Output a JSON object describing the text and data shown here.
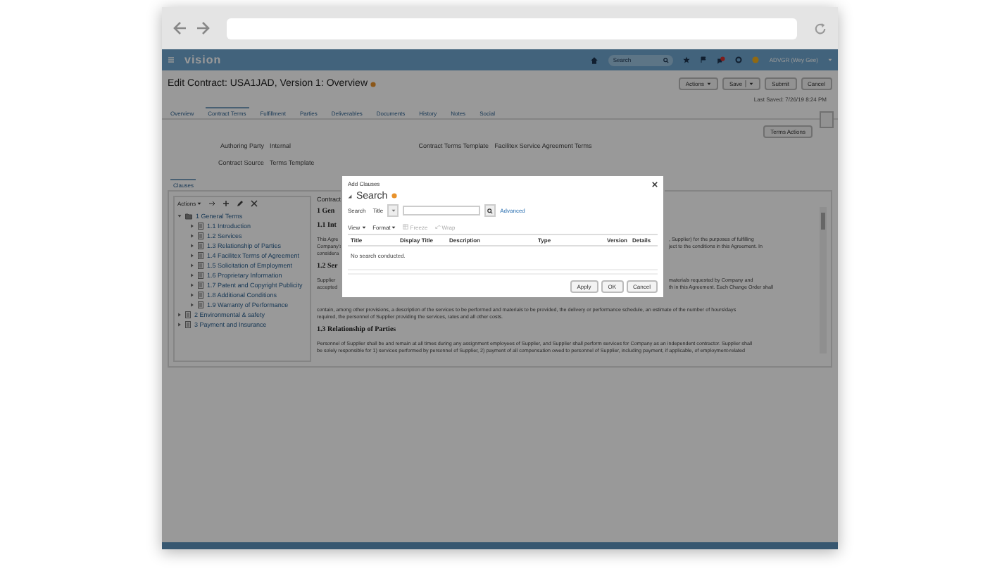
{
  "app": {
    "logo": "vision",
    "search": {
      "placeholder": "Search"
    },
    "user": "ADVGR (Wey Gee)"
  },
  "page": {
    "title": "Edit Contract: USA1JAD, Version 1: Overview",
    "buttons": [
      {
        "label": "Actions",
        "kind": "menu"
      },
      {
        "label": "Save",
        "kind": "split"
      },
      {
        "label": "Submit",
        "kind": "plain"
      },
      {
        "label": "Cancel",
        "kind": "plain"
      }
    ],
    "last_saved": "Last Saved: 7/26/19 8:24 PM"
  },
  "tabs": [
    {
      "label": "Overview",
      "selected": false
    },
    {
      "label": "Contract Terms",
      "selected": true
    },
    {
      "label": "Fulfillment",
      "selected": false
    },
    {
      "label": "Parties",
      "selected": false
    },
    {
      "label": "Deliverables",
      "selected": false
    },
    {
      "label": "Documents",
      "selected": false
    },
    {
      "label": "History",
      "selected": false
    },
    {
      "label": "Notes",
      "selected": false
    },
    {
      "label": "Social",
      "selected": false
    }
  ],
  "terms_actions": "Terms Actions",
  "fields": [
    {
      "label": "Authoring Party",
      "value": "Internal"
    },
    {
      "label": "Contract Terms Template",
      "value": "Facilitex Service Agreement Terms"
    },
    {
      "label": "Contract Source",
      "value": "Terms Template"
    }
  ],
  "clauses_tab": {
    "label": "Clauses",
    "selected": true
  },
  "tree": {
    "actions": "Actions",
    "items": [
      {
        "label": "1 General Terms",
        "expanded": true,
        "children": [
          {
            "label": "1.1 Introduction",
            "expanded": false
          },
          {
            "label": "1.2 Services",
            "expanded": false
          },
          {
            "label": "1.3 Relationship of Parties",
            "expanded": false
          },
          {
            "label": "1.4 Facilitex Terms of Agreement",
            "expanded": false
          },
          {
            "label": "1.5 Solicitation of Employment",
            "expanded": false
          },
          {
            "label": "1.6 Proprietary Information",
            "expanded": false
          },
          {
            "label": "1.7 Patent and Copyright Publicity",
            "expanded": false
          },
          {
            "label": "1.8 Additional Conditions",
            "expanded": false
          },
          {
            "label": "1.9 Warranty of Performance",
            "expanded": false
          }
        ]
      },
      {
        "label": "2 Environmental & safety",
        "expanded": false
      },
      {
        "label": "3 Payment and Insurance",
        "expanded": false
      }
    ]
  },
  "contract": {
    "header": "Contract",
    "blocks": [
      {
        "kind": "heading",
        "left": [
          "1 Gen"
        ]
      },
      {
        "kind": "heading",
        "left": [
          "1.1 Int"
        ]
      },
      {
        "kind": "para",
        "left": [
          "This Agre",
          "Company's",
          "considera"
        ],
        "right": [
          ", Supplier) for the purposes of fulfilling",
          "ject to the conditions in this Agreement. In"
        ]
      },
      {
        "kind": "heading",
        "left": [
          "1.2 Ser"
        ]
      },
      {
        "kind": "para",
        "left": [
          "Supplier",
          "accepted"
        ],
        "right": [
          "materials requested by Company and",
          "th in this Agreement. Each Change Order shall"
        ]
      },
      {
        "kind": "full",
        "lines": [
          "contain, among other provisions, a description of the services to be performed and materials to be provided, the delivery or performance schedule, an estimate of the number of hours/days",
          "required, the personnel of Supplier providing the services, rates and all other costs."
        ]
      },
      {
        "kind": "fullheading",
        "lines": [
          "1.3 Relationship of Parties"
        ]
      },
      {
        "kind": "full",
        "lines": [
          "Personnel of Supplier shall be and remain at all times during any assignment employees of Supplier, and Supplier shall perform services for Company as an independent contractor. Supplier shall",
          "be solely responsible for 1) services performed by personnel of Supplier, 2) payment of all compensation owed to personnel of Supplier, including payment, if applicable, of employment-related"
        ]
      }
    ]
  },
  "dialog": {
    "title": "Add Clauses",
    "section": "Search",
    "search_label": "Search",
    "search_by": "Title",
    "advanced": "Advanced",
    "view": "View",
    "format": "Format",
    "freeze": {
      "label": "Freeze",
      "disabled": true
    },
    "wrap": {
      "label": "Wrap",
      "disabled": true
    },
    "columns": [
      "Title",
      "Display Title",
      "Description",
      "Type",
      "Version",
      "Details"
    ],
    "empty": "No search conducted.",
    "buttons": [
      "Apply",
      "OK",
      "Cancel"
    ]
  }
}
